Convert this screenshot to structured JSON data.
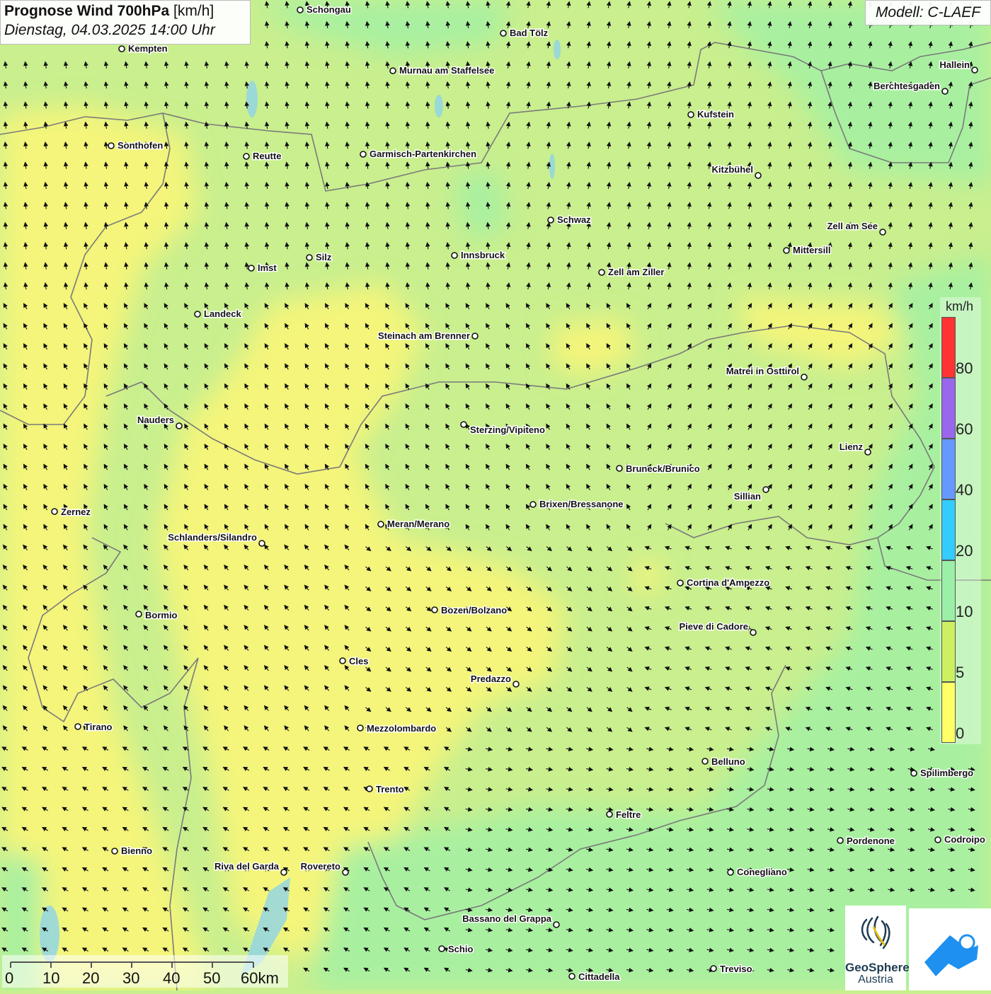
{
  "header": {
    "title_bold": "Prognose Wind 700hPa",
    "title_unit": "[km/h]",
    "datetime": "Dienstag, 04.03.2025 14:00 Uhr"
  },
  "model": "Modell: C-LAEF",
  "legend": {
    "unit": "km/h",
    "bins": [
      {
        "color": "#ff3333"
      },
      {
        "color": "#9966ee"
      },
      {
        "color": "#6699ff"
      },
      {
        "color": "#33ccff"
      },
      {
        "color": "#99f0a6"
      },
      {
        "color": "#ccf060"
      },
      {
        "color": "#ffff66"
      }
    ],
    "ticks": [
      "80",
      "60",
      "40",
      "20",
      "10",
      "5",
      "0"
    ]
  },
  "scale": {
    "labels": [
      "0",
      "10",
      "20",
      "30",
      "40",
      "50",
      "60km"
    ]
  },
  "logos": {
    "geosphere_line1": "GeoSphere",
    "geosphere_line2": "Austria"
  },
  "cities": [
    {
      "name": "Schongau"
    },
    {
      "name": "Bad Tölz"
    },
    {
      "name": "Kempten"
    },
    {
      "name": "Murnau am Staffelsee"
    },
    {
      "name": "Hallein"
    },
    {
      "name": "Berchtesgaden"
    },
    {
      "name": "Kufstein"
    },
    {
      "name": "Sonthofen"
    },
    {
      "name": "Reutte"
    },
    {
      "name": "Garmisch-Partenkirchen"
    },
    {
      "name": "Kitzbühel"
    },
    {
      "name": "Schwaz"
    },
    {
      "name": "Zell am See"
    },
    {
      "name": "Mittersill"
    },
    {
      "name": "Innsbruck"
    },
    {
      "name": "Silz"
    },
    {
      "name": "Imst"
    },
    {
      "name": "Zell am Ziller"
    },
    {
      "name": "Landeck"
    },
    {
      "name": "Steinach am Brenner"
    },
    {
      "name": "Matrei in Osttirol"
    },
    {
      "name": "Nauders"
    },
    {
      "name": "Sterzing/Vipiteno"
    },
    {
      "name": "Lienz"
    },
    {
      "name": "Bruneck/Brunico"
    },
    {
      "name": "Sillian"
    },
    {
      "name": "Zernez"
    },
    {
      "name": "Brixen/Bressanone"
    },
    {
      "name": "Meran/Merano"
    },
    {
      "name": "Schlanders/Silandro"
    },
    {
      "name": "Cortina d'Ampezzo"
    },
    {
      "name": "Bormio"
    },
    {
      "name": "Bozen/Bolzano"
    },
    {
      "name": "Pieve di Cadore"
    },
    {
      "name": "Cles"
    },
    {
      "name": "Predazzo"
    },
    {
      "name": "Tirano"
    },
    {
      "name": "Mezzolombardo"
    },
    {
      "name": "Belluno"
    },
    {
      "name": "Spilimbergo"
    },
    {
      "name": "Trento"
    },
    {
      "name": "Feltre"
    },
    {
      "name": "Pordenone"
    },
    {
      "name": "Codroipo"
    },
    {
      "name": "Bienno"
    },
    {
      "name": "Riva del Garda"
    },
    {
      "name": "Rovereto"
    },
    {
      "name": "Conegliano"
    },
    {
      "name": "Bassano del Grappa"
    },
    {
      "name": "Schio"
    },
    {
      "name": "Treviso"
    },
    {
      "name": "Cittadella"
    }
  ]
}
